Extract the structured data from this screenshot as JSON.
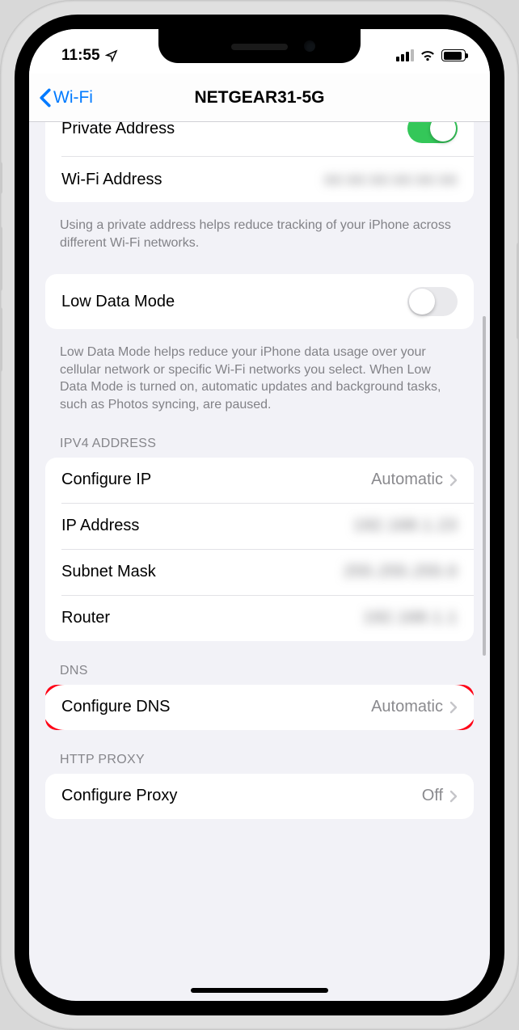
{
  "status": {
    "time": "11:55"
  },
  "nav": {
    "back_label": "Wi-Fi",
    "title": "NETGEAR31-5G"
  },
  "private": {
    "label": "Private Address",
    "wifi_address_label": "Wi-Fi Address",
    "wifi_address_value": "xx:xx:xx:xx:xx:xx",
    "footer": "Using a private address helps reduce tracking of your iPhone across different Wi-Fi networks."
  },
  "lowdata": {
    "label": "Low Data Mode",
    "footer": "Low Data Mode helps reduce your iPhone data usage over your cellular network or specific Wi-Fi networks you select. When Low Data Mode is turned on, automatic updates and background tasks, such as Photos syncing, are paused."
  },
  "ipv4": {
    "header": "IPV4 ADDRESS",
    "configure_ip_label": "Configure IP",
    "configure_ip_value": "Automatic",
    "ip_label": "IP Address",
    "ip_value": "192.168.1.23",
    "subnet_label": "Subnet Mask",
    "subnet_value": "255.255.255.0",
    "router_label": "Router",
    "router_value": "192.168.1.1"
  },
  "dns": {
    "header": "DNS",
    "label": "Configure DNS",
    "value": "Automatic"
  },
  "proxy": {
    "header": "HTTP PROXY",
    "label": "Configure Proxy",
    "value": "Off"
  }
}
